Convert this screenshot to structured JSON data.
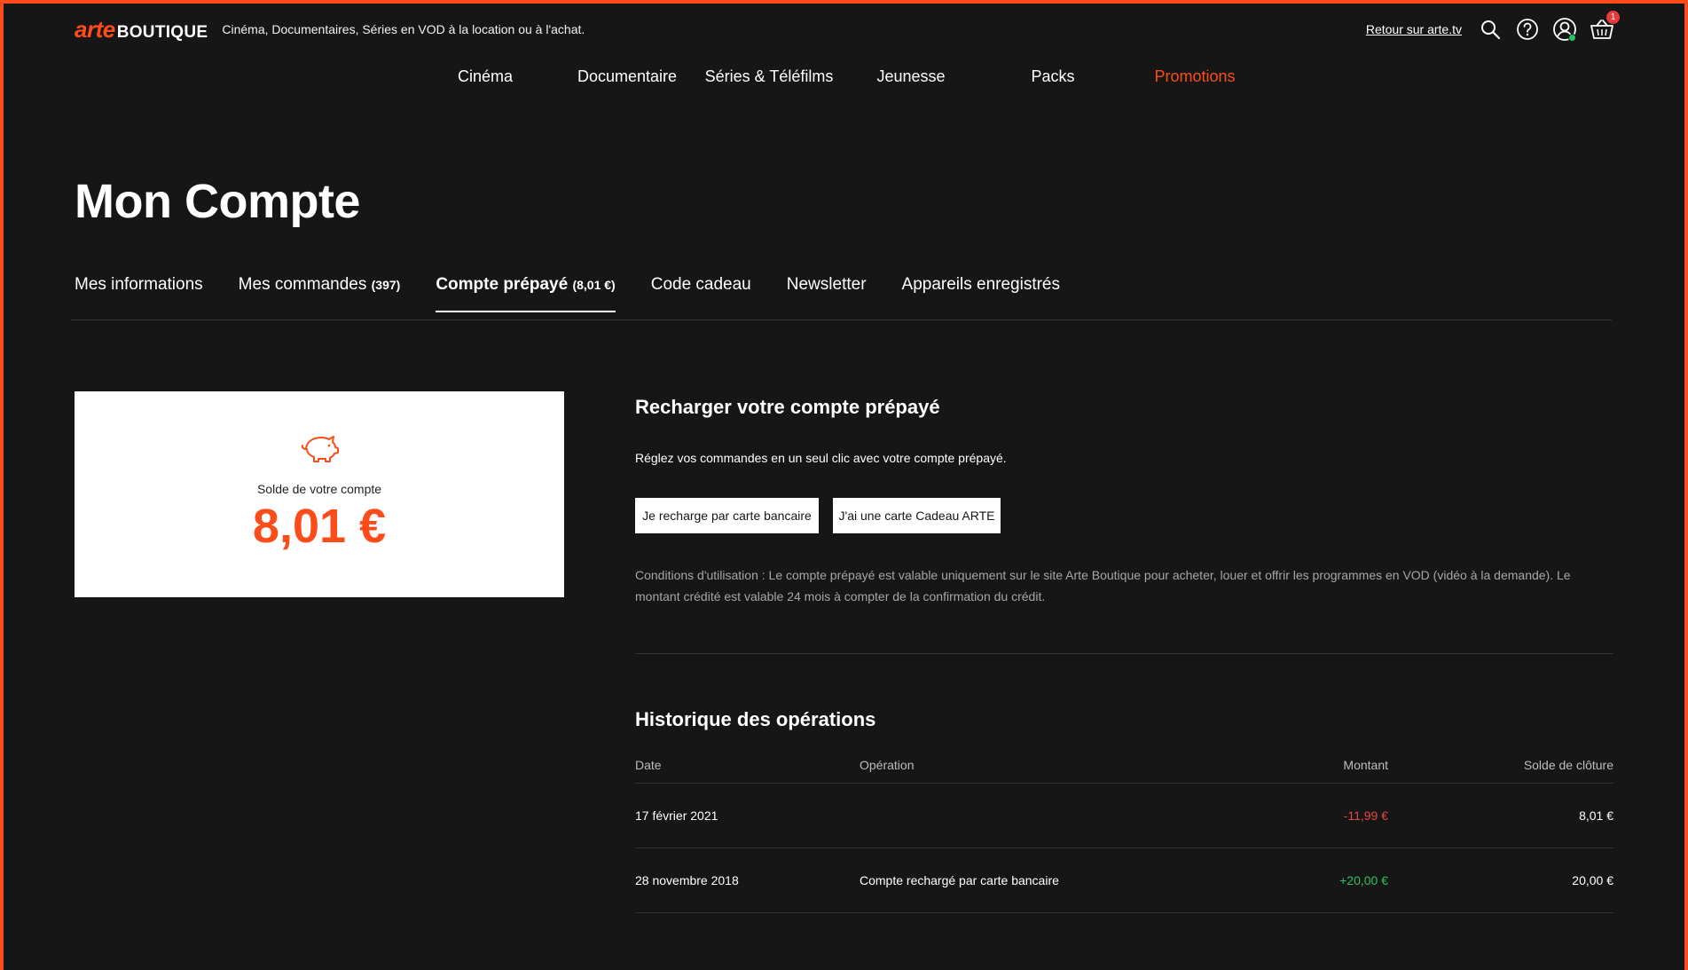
{
  "header": {
    "logo_arte": "arte",
    "logo_boutique": "BOUTIQUE",
    "tagline": "Cinéma, Documentaires, Séries en VOD à la location ou à l'achat.",
    "back_link": "Retour sur arte.tv",
    "cart_count": "1",
    "icons": [
      "search-icon",
      "help-icon",
      "user-icon",
      "cart-icon"
    ]
  },
  "nav": {
    "items": [
      "Cinéma",
      "Documentaire",
      "Séries & Téléfilms",
      "Jeunesse",
      "Packs",
      "Promotions"
    ]
  },
  "page": {
    "title": "Mon Compte"
  },
  "tabs": {
    "info": "Mes informations",
    "orders": "Mes commandes",
    "orders_count": "(397)",
    "prepaid": "Compte prépayé",
    "prepaid_amount": "(8,01 €)",
    "gift": "Code cadeau",
    "newsletter": "Newsletter",
    "devices": "Appareils enregistrés"
  },
  "balance": {
    "label": "Solde de votre compte",
    "amount": "8,01 €"
  },
  "recharge": {
    "title": "Recharger votre compte prépayé",
    "description": "Réglez vos commandes en un seul clic avec votre compte prépayé.",
    "btn_card": "Je recharge par carte bancaire",
    "btn_gift": "J'ai une carte Cadeau ARTE",
    "conditions": "Conditions d'utilisation : Le compte prépayé est valable uniquement sur le site Arte Boutique pour acheter, louer et offrir les programmes en VOD (vidéo à la demande). Le montant crédité est valable 24 mois à compter de la confirmation du crédit."
  },
  "history": {
    "title": "Historique des opérations",
    "columns": [
      "Date",
      "Opération",
      "Montant",
      "Solde de clôture"
    ],
    "rows": [
      {
        "date": "17 février 2021",
        "operation": "",
        "amount": "-11,99 €",
        "balance": "8,01 €"
      },
      {
        "date": "28 novembre 2018",
        "operation": "Compte rechargé par carte bancaire",
        "amount": "+20,00 €",
        "balance": "20,00 €"
      }
    ]
  },
  "colors": {
    "accent": "#fc4c19",
    "background": "#161616",
    "negative": "#e5483c",
    "positive": "#2fbf5a"
  }
}
